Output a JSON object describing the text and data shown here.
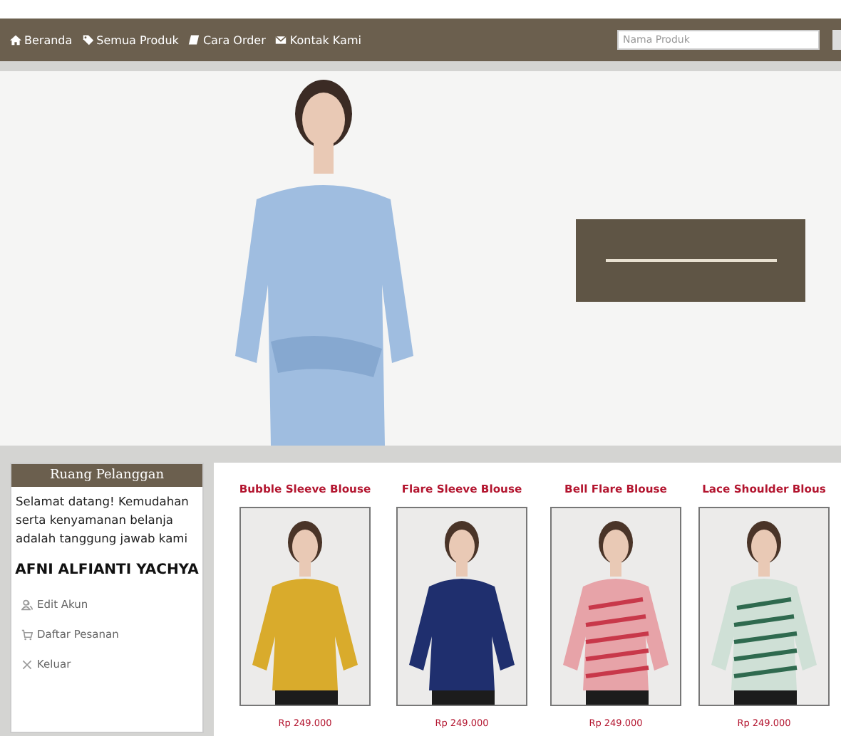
{
  "nav": {
    "items": [
      {
        "label": "Beranda"
      },
      {
        "label": "Semua Produk"
      },
      {
        "label": "Cara Order"
      },
      {
        "label": "Kontak Kami"
      }
    ],
    "search": {
      "placeholder": "Nama Produk"
    }
  },
  "sidebar": {
    "title": "Ruang Pelanggan",
    "welcome": "Selamat datang! Kemudahan serta kenyamanan belanja adalah tanggung jawab kami",
    "user": "AFNI ALFIANTI YACHYA",
    "menu": [
      {
        "label": "Edit Akun"
      },
      {
        "label": "Daftar Pesanan"
      },
      {
        "label": "Keluar"
      }
    ]
  },
  "products": [
    {
      "name": "Bubble Sleeve Blouse",
      "price": "Rp 249.000"
    },
    {
      "name": "Flare Sleeve Blouse",
      "price": "Rp 249.000"
    },
    {
      "name": "Bell Flare Blouse",
      "price": "Rp 249.000"
    },
    {
      "name": "Lace Shoulder Blous",
      "price": "Rp 249.000"
    }
  ]
}
